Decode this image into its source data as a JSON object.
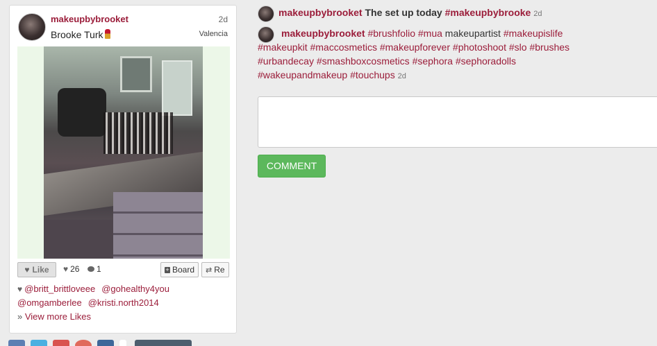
{
  "post": {
    "username": "makeupbybrooket",
    "real_name": "Brooke Turk",
    "time": "2d",
    "location": "Valencia",
    "actions": {
      "like_label": "Like",
      "likes_count": "26",
      "comments_count": "1",
      "board_label": "Board",
      "re_label": "Re"
    },
    "likers": [
      "@britt_brittloveee",
      "@gohealthy4you",
      "@omgamberlee",
      "@kristi.north2014"
    ],
    "view_more": "View more Likes"
  },
  "comments": [
    {
      "username": "makeupbybrooket",
      "text": "The set up today",
      "tag": "#makeupbybrooke",
      "time": "2d"
    },
    {
      "username": "makeupbybrooket",
      "line1": [
        "#brushfolio",
        "#mua",
        "makeupartist",
        "#makeupislife"
      ],
      "line2": [
        "#makeupkit",
        "#maccosmetics",
        "#makeupforever",
        "#photoshoot",
        "#slo",
        "#brushes"
      ],
      "line3": [
        "#urbandecay",
        "#smashboxcosmetics",
        "#sephora",
        "#sephoradolls"
      ],
      "line4": [
        "#wakeupandmakeup",
        "#touchups"
      ],
      "time": "2d"
    }
  ],
  "comment_form": {
    "placeholder": "",
    "button_label": "COMMENT"
  },
  "icons": {
    "heart": "heart-icon",
    "comment": "comment-bubble-icon",
    "board": "plus-box-icon",
    "repost": "repost-icon",
    "lipstick": "lipstick-emoji"
  },
  "colors": {
    "brand": "#9b1d3a",
    "comment_button": "#5cb85c",
    "background": "#ececec"
  }
}
